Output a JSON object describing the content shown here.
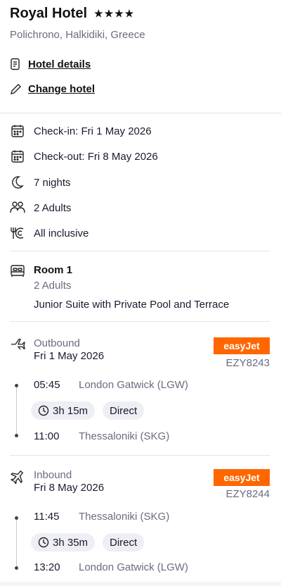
{
  "hotel": {
    "name": "Royal Hotel",
    "stars": "★★★★",
    "location": "Polichrono, Halkidiki, Greece",
    "details_link": "Hotel details",
    "change_link": "Change hotel"
  },
  "stay": {
    "check_in": "Check-in: Fri 1 May 2026",
    "check_out": "Check-out: Fri 8 May 2026",
    "nights": "7 nights",
    "guests": "2 Adults",
    "board": "All inclusive"
  },
  "room": {
    "title": "Room 1",
    "guests": "2 Adults",
    "type": "Junior Suite with Private Pool and Terrace"
  },
  "outbound": {
    "label": "Outbound",
    "date": "Fri 1 May 2026",
    "airline": "easyJet",
    "flight_no": "EZY8243",
    "depart_time": "05:45",
    "depart_airport": "London Gatwick (LGW)",
    "duration": "3h 15m",
    "stops": "Direct",
    "arrive_time": "11:00",
    "arrive_airport": "Thessaloniki (SKG)"
  },
  "inbound": {
    "label": "Inbound",
    "date": "Fri 8 May 2026",
    "airline": "easyJet",
    "flight_no": "EZY8244",
    "depart_time": "11:45",
    "depart_airport": "Thessaloniki (SKG)",
    "duration": "3h 35m",
    "stops": "Direct",
    "arrive_time": "13:20",
    "arrive_airport": "London Gatwick (LGW)"
  },
  "colors": {
    "airline_brand": "#ff6600",
    "chip_bg": "#eeeef5",
    "muted_text": "#6b6b80"
  }
}
